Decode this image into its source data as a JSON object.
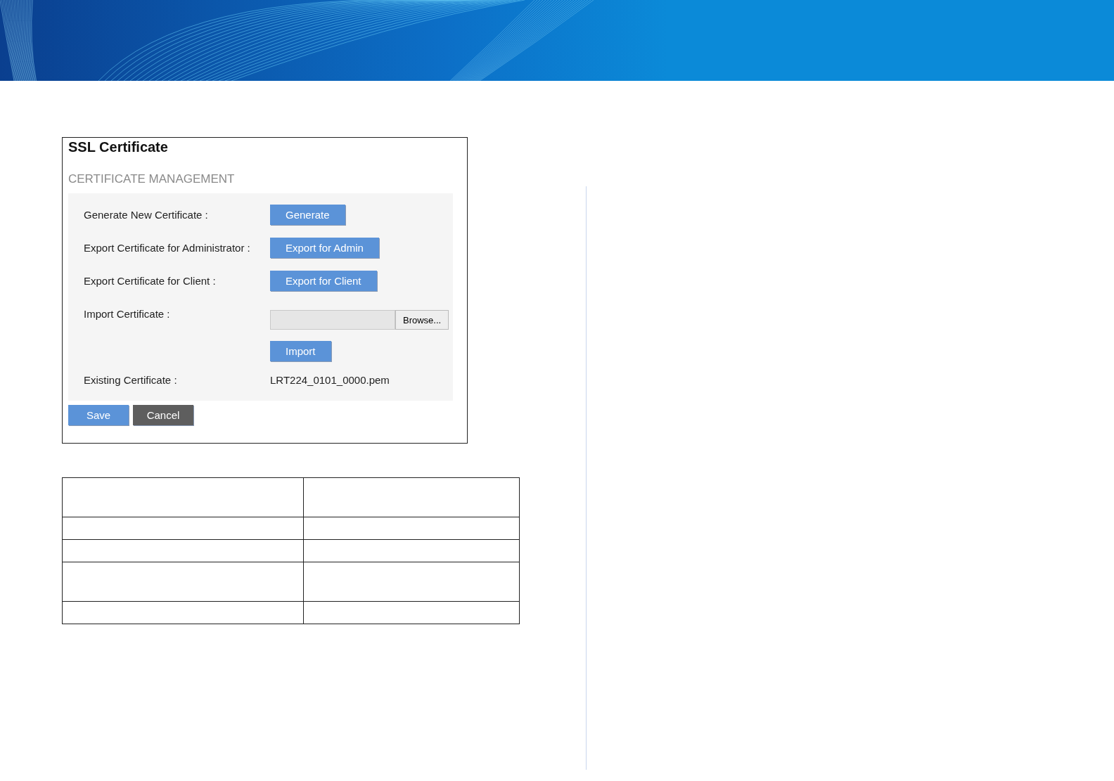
{
  "screenshot": {
    "title": "SSL Certificate",
    "section": "CERTIFICATE MANAGEMENT",
    "rows": [
      {
        "kind": "button",
        "label": "Generate New Certificate :",
        "button": "Generate"
      },
      {
        "kind": "button",
        "label": "Export Certificate for Administrator :",
        "button": "Export for Admin"
      },
      {
        "kind": "button",
        "label": "Export Certificate for Client :",
        "button": "Export for Client"
      },
      {
        "kind": "file",
        "label": "Import Certificate :",
        "browse": "Browse...",
        "button": "Import"
      },
      {
        "kind": "text",
        "label": "Existing Certificate :",
        "value": "LRT224_0101_0000.pem"
      }
    ],
    "actions": [
      {
        "label": "Save",
        "kind": "primary"
      },
      {
        "label": "Cancel",
        "kind": "secondary"
      }
    ]
  }
}
